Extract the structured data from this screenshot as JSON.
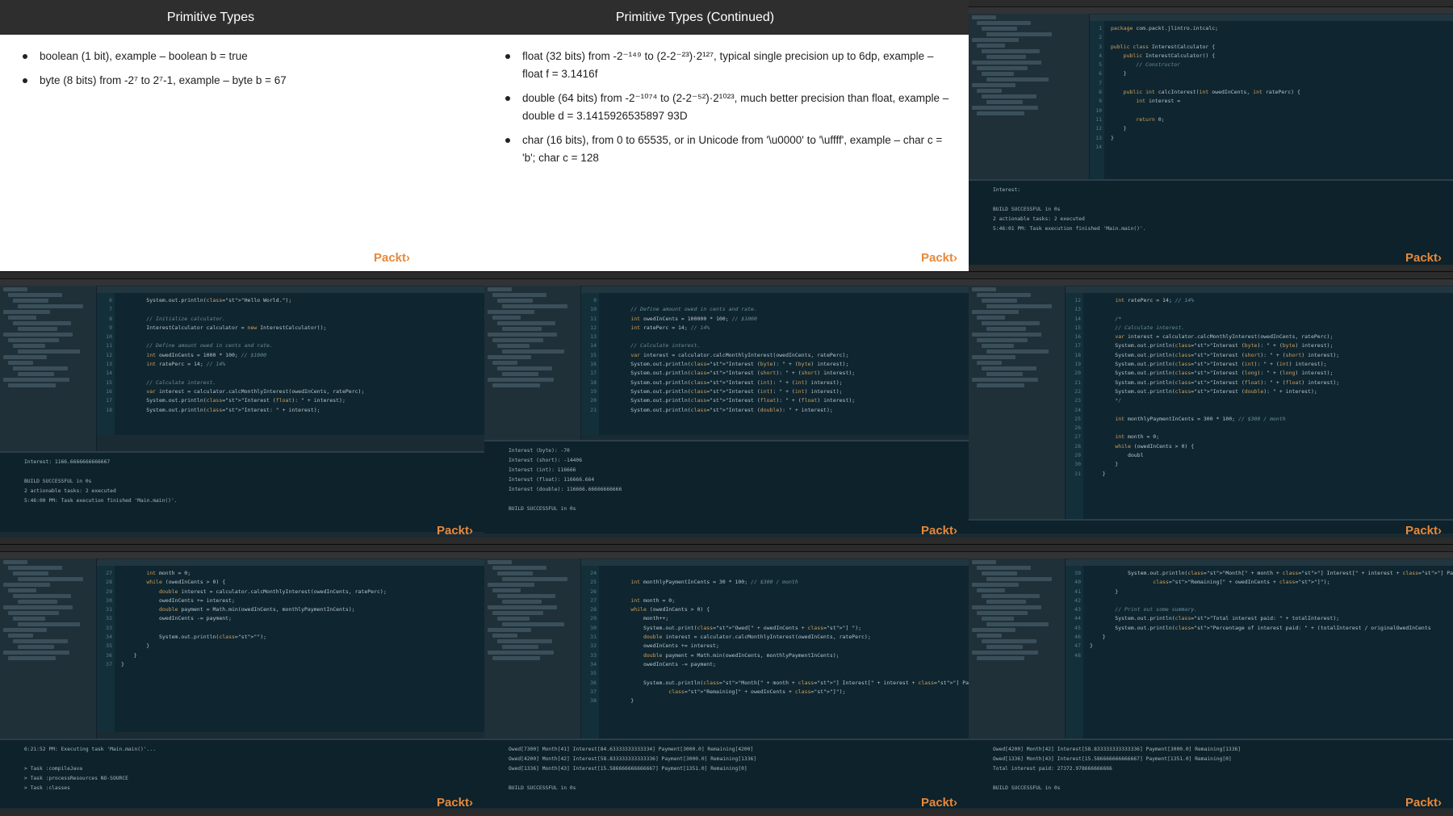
{
  "slides": [
    {
      "title": "Primitive Types",
      "bullets": [
        "boolean (1 bit), example – boolean b = true",
        "byte (8 bits) from -2⁷ to 2⁷-1, example – byte b = 67"
      ],
      "logo": "Packt›"
    },
    {
      "title": "Primitive Types (Continued)",
      "bullets": [
        "float (32 bits) from -2⁻¹⁴⁹ to (2-2⁻²³)·2¹²⁷, typical single precision up to 6dp, example – float f = 3.1416f",
        "double (64 bits) from -2⁻¹⁰⁷⁴ to (2-2⁻⁵²)·2¹⁰²³, much better precision than float, example – double d = 3.1415926535897 93D",
        "char (16 bits), from 0 to 65535, or in Unicode from '\\u0000' to '\\uffff', example – char c = 'b'; char c = 128"
      ],
      "logo": "Packt›"
    }
  ],
  "ide_tiles": [
    {
      "lines": [
        "1",
        "2",
        "3",
        "4",
        "5",
        "6",
        "7",
        "8",
        "9",
        "10",
        "11",
        "12",
        "13",
        "14"
      ],
      "code": [
        "package com.packt.jlintro.intcalc;",
        "",
        "public class InterestCalculator {",
        "    public InterestCalculator() {",
        "        // Constructor",
        "    }",
        "",
        "    public int calcInterest(int owedInCents, int ratePerc) {",
        "        int interest = ",
        "",
        "        return 0;",
        "    }",
        "}",
        ""
      ],
      "console": [
        "Interest: ",
        "",
        "BUILD SUCCESSFUL in 0s",
        "2 actionable tasks: 2 executed",
        "5:46:01 PM: Task execution finished 'Main.main()'."
      ],
      "logo": "Packt›"
    },
    {
      "lines": [
        "6",
        "7",
        "8",
        "9",
        "10",
        "11",
        "12",
        "13",
        "14",
        "15",
        "16",
        "17",
        "18"
      ],
      "code": [
        "        System.out.println(\"Hello World.\");",
        "",
        "        // Initialize calculator.",
        "        InterestCalculator calculator = new InterestCalculator();",
        "",
        "        // Define amount owed in cents and rate.",
        "        int owedInCents = 1000 * 100; // $1000",
        "        int ratePerc = 14; // 14%",
        "",
        "        // Calculate interest.",
        "        var interest = calculator.calcMonthlyInterest(owedInCents, ratePerc);",
        "        System.out.println(\"Interest (float): \" + interest);",
        "        System.out.println(\"Interest: \" + interest);"
      ],
      "console": [
        "Interest: 1166.6666666666667",
        "",
        "BUILD SUCCESSFUL in 0s",
        "2 actionable tasks: 2 executed",
        "5:46:00 PM: Task execution finished 'Main.main()'."
      ],
      "logo": "Packt›"
    },
    {
      "lines": [
        "9",
        "10",
        "11",
        "12",
        "13",
        "14",
        "15",
        "16",
        "17",
        "18",
        "19",
        "20",
        "21"
      ],
      "code": [
        "",
        "        // Define amount owed in cents and rate.",
        "        int owedInCents = 100000 * 100; // $1000",
        "        int ratePerc = 14; // 14%",
        "",
        "        // Calculate interest.",
        "        var interest = calculator.calcMonthlyInterest(owedInCents, ratePerc);",
        "        System.out.println(\"Interest (byte): \" + (byte) interest);",
        "        System.out.println(\"Interest (short): \" + (short) interest);",
        "        System.out.println(\"Interest (int): \" + (int) interest);",
        "        System.out.println(\"Interest (int): \" + (int) interest);",
        "        System.out.println(\"Interest (float): \" + (float) interest);",
        "        System.out.println(\"Interest (double): \" + interest);"
      ],
      "console": [
        "Interest (byte): -70",
        "Interest (short): -14406",
        "Interest (int): 116666",
        "Interest (float): 116666.664",
        "Interest (double): 116666.66666666666",
        "",
        "BUILD SUCCESSFUL in 0s"
      ],
      "logo": "Packt›"
    },
    {
      "lines": [
        "12",
        "13",
        "14",
        "15",
        "16",
        "17",
        "18",
        "19",
        "20",
        "21",
        "22",
        "23",
        "24",
        "25",
        "26",
        "27",
        "28",
        "29",
        "30",
        "31"
      ],
      "code": [
        "        int ratePerc = 14; // 14%",
        "",
        "        /*",
        "        // Calculate interest.",
        "        var interest = calculator.calcMonthlyInterest(owedInCents, ratePerc);",
        "        System.out.println(\"Interest (byte): \" + (byte) interest);",
        "        System.out.println(\"Interest (short): \" + (short) interest);",
        "        System.out.println(\"Interest (int): \" + (int) interest);",
        "        System.out.println(\"Interest (long): \" + (long) interest);",
        "        System.out.println(\"Interest (float): \" + (float) interest);",
        "        System.out.println(\"Interest (double): \" + interest);",
        "        */",
        "",
        "        int monthlyPaymentInCents = 300 * 100; // $300 / month",
        "",
        "        int month = 0;",
        "        while (owedInCents > 0) {",
        "            doubl",
        "        }",
        "    }"
      ],
      "console": [],
      "logo": "Packt›"
    },
    {
      "lines": [
        "27",
        "28",
        "29",
        "30",
        "31",
        "32",
        "33",
        "34",
        "35",
        "36",
        "37"
      ],
      "code": [
        "        int month = 0;",
        "        while (owedInCents > 0) {",
        "            double interest = calculator.calcMonthlyInterest(owedInCents, ratePerc);",
        "            owedInCents += interest;",
        "            double payment = Math.min(owedInCents, monthlyPaymentInCents);",
        "            owedInCents -= payment;",
        "",
        "            System.out.println(\"\");",
        "        }",
        "    }",
        "}"
      ],
      "console": [
        "6:21:52 PM: Executing task 'Main.main()'...",
        "",
        "> Task :compileJava",
        "> Task :processResources NO-SOURCE",
        "> Task :classes"
      ],
      "logo": "Packt›"
    },
    {
      "lines": [
        "24",
        "25",
        "26",
        "27",
        "28",
        "29",
        "30",
        "31",
        "32",
        "33",
        "34",
        "35",
        "36",
        "37",
        "38"
      ],
      "code": [
        "",
        "        int monthlyPaymentInCents = 30 * 100; // $300 / month",
        "",
        "        int month = 0;",
        "        while (owedInCents > 0) {",
        "            month++;",
        "            System.out.print(\"Owed[\" + owedInCents + \"] \");",
        "            double interest = calculator.calcMonthlyInterest(owedInCents, ratePerc);",
        "            owedInCents += interest;",
        "            double payment = Math.min(owedInCents, monthlyPaymentInCents);",
        "            owedInCents -= payment;",
        "",
        "            System.out.println(\"Month[\" + month + \"] Interest[\" + interest + \"] Payment[\" + payment",
        "                    \"Remaining[\" + owedInCents + \"]\");",
        "        }"
      ],
      "console": [
        "Owed[7300] Month[41] Interest[84.63333333333334] Payment[3000.0] Remaining[4200]",
        "Owed[4200] Month[42] Interest[58.833333333333336] Payment[3000.0] Remaining[1336]",
        "Owed[1336] Month[43] Interest[15.586666666666667] Payment[1351.0] Remaining[0]",
        "",
        "BUILD SUCCESSFUL in 0s"
      ],
      "logo": "Packt›"
    },
    {
      "lines": [
        "39",
        "40",
        "41",
        "42",
        "43",
        "44",
        "45",
        "46",
        "47",
        "48"
      ],
      "code": [
        "            System.out.println(\"Month[\" + month + \"] Interest[\" + interest + \"] Payment[\" + payment",
        "                    \"Remaining[\" + owedInCents + \"]\");",
        "        }",
        "",
        "        // Print out some summary.",
        "        System.out.println(\"Total interest paid: \" + totalInterest);",
        "        System.out.println(\"Percentage of interest paid: \" + (totalInterest / originalOwedInCents",
        "    }",
        "}",
        ""
      ],
      "console": [
        "Owed[4200] Month[42] Interest[58.833333333333336] Payment[3000.0] Remaining[1336]",
        "Owed[1336] Month[43] Interest[15.586666666666667] Payment[1351.0] Remaining[0]",
        "Total interest paid: 27372.978666666666",
        "",
        "BUILD SUCCESSFUL in 0s"
      ],
      "logo": "Packt›"
    }
  ],
  "colors": {
    "ide_background": "#0f2630",
    "slide_header": "#2e2e2e",
    "packt_logo": "#e8883a"
  }
}
